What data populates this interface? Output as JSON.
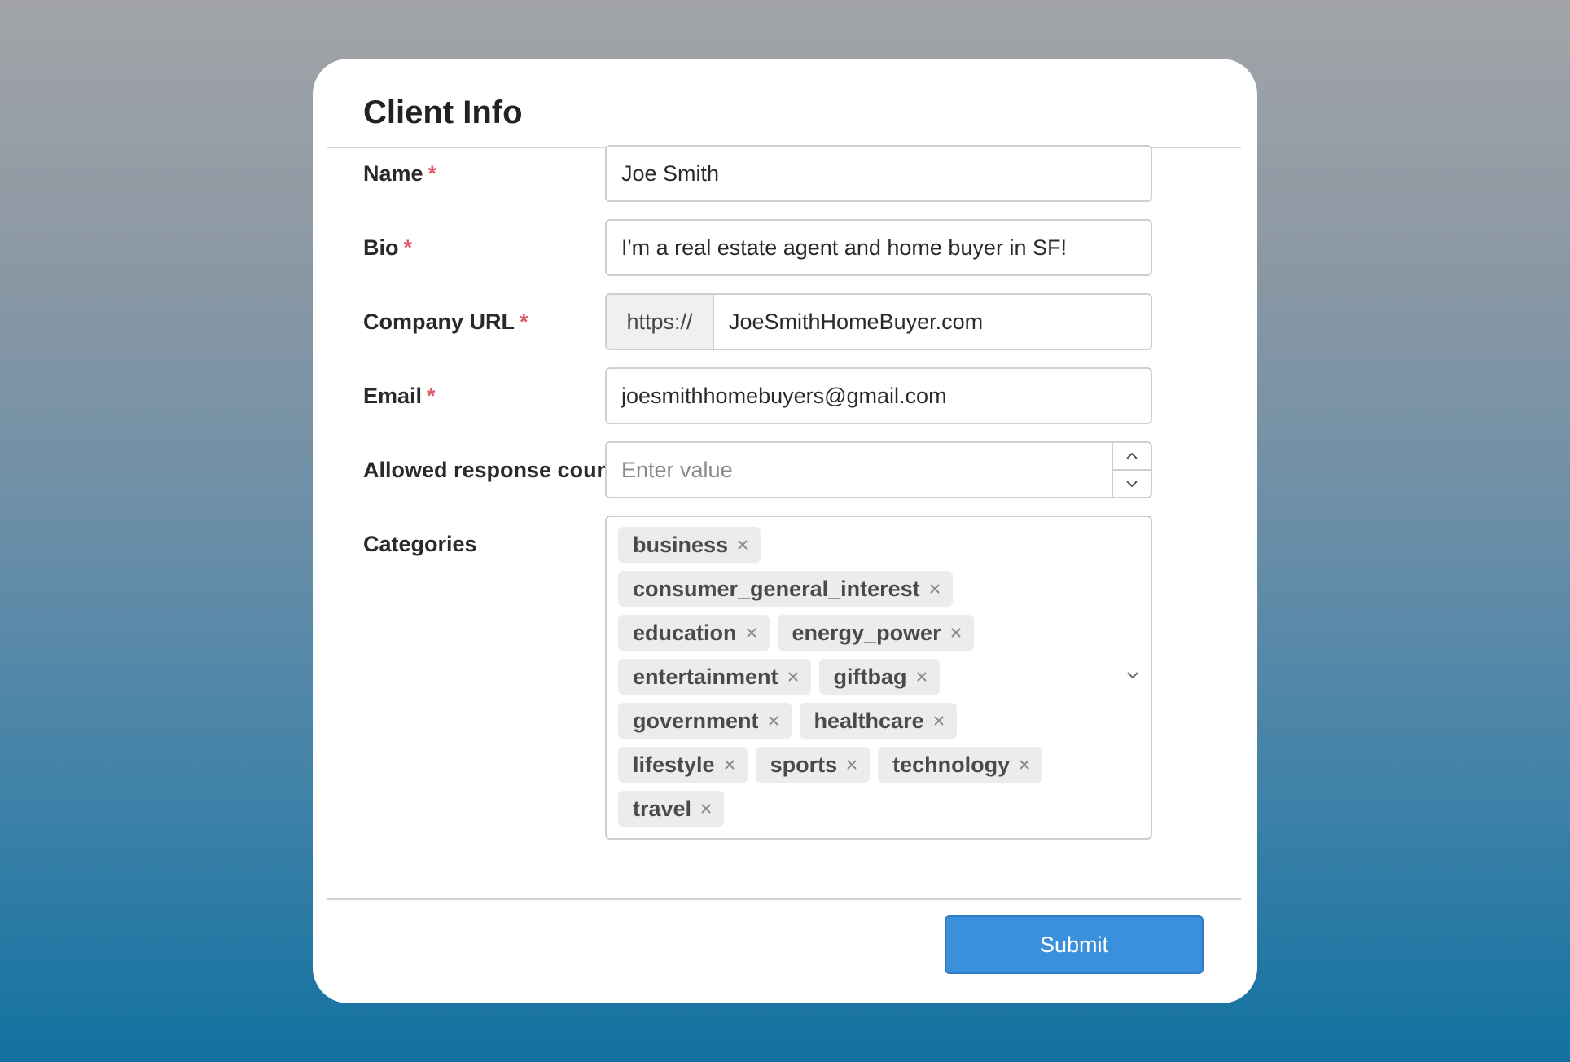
{
  "form": {
    "title": "Client Info",
    "required_marker": "*",
    "fields": {
      "name": {
        "label": "Name",
        "value": "Joe Smith",
        "required": true
      },
      "bio": {
        "label": "Bio",
        "value": "I'm a real estate agent and home buyer in SF!",
        "required": true
      },
      "company_url": {
        "label": "Company URL",
        "prefix": "https://",
        "value": "JoeSmithHomeBuyer.com",
        "required": true
      },
      "email": {
        "label": "Email",
        "value": "joesmithhomebuyers@gmail.com",
        "required": true
      },
      "allowed_response_count": {
        "label": "Allowed response count",
        "value": "",
        "placeholder": "Enter value",
        "required": false
      },
      "categories": {
        "label": "Categories",
        "required": false,
        "tags": [
          "business",
          "consumer_general_interest",
          "education",
          "energy_power",
          "entertainment",
          "giftbag",
          "government",
          "healthcare",
          "lifestyle",
          "sports",
          "technology",
          "travel"
        ]
      }
    },
    "submit_label": "Submit"
  },
  "icons": {
    "tag_remove": "close-icon",
    "stepper_up": "chevron-up-icon",
    "stepper_down": "chevron-down-icon",
    "dropdown": "chevron-down-icon"
  },
  "colors": {
    "accent": "#3b90dc",
    "required": "#e05a6a",
    "tag_background": "#ececec"
  }
}
